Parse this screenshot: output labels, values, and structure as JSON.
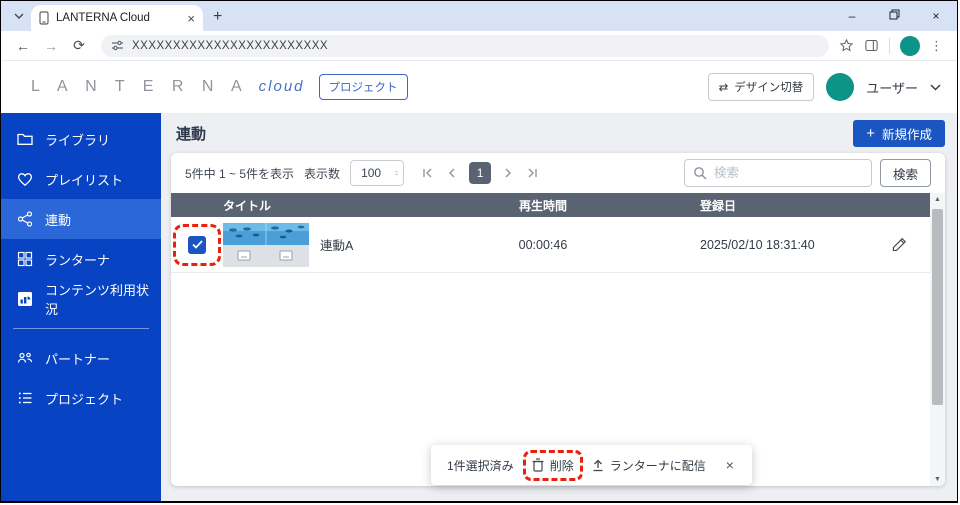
{
  "browser": {
    "tab_title": "LANTERNA Cloud",
    "url": "XXXXXXXXXXXXXXXXXXXXXXXX",
    "new_tab": "+",
    "minimize": "–",
    "close": "×",
    "kebab": "⋮",
    "tab_close": "×"
  },
  "header": {
    "logo_main": "L A N T E R N A",
    "logo_sub": "cloud",
    "project_button": "プロジェクト",
    "design_switch_icon": "⇄",
    "design_switch": "デザイン切替",
    "user": "ユーザー"
  },
  "sidebar": {
    "items": [
      {
        "label": "ライブラリ"
      },
      {
        "label": "プレイリスト"
      },
      {
        "label": "連動"
      },
      {
        "label": "ランターナ"
      },
      {
        "label": "コンテンツ利用状況"
      },
      {
        "label": "パートナー"
      },
      {
        "label": "プロジェクト"
      }
    ]
  },
  "main": {
    "title": "連動",
    "create_button": "新規作成",
    "create_plus": "+",
    "pagination": {
      "summary": "5件中 1 ~ 5件を表示",
      "per_page_label": "表示数",
      "per_page_value": "100",
      "page": "1"
    },
    "search": {
      "placeholder": "検索",
      "button": "検索"
    },
    "table": {
      "headers": [
        "タイトル",
        "再生時間",
        "登録日"
      ],
      "rows": [
        {
          "title": "連動A",
          "duration": "00:00:46",
          "registered": "2025/02/10 18:31:40"
        }
      ]
    },
    "selection_bar": {
      "selected_count": "1件選択済み",
      "delete": "削除",
      "distribute": "ランターナに配信",
      "close": "×"
    }
  },
  "colors": {
    "sidebar_blue": "#0743c2",
    "active_item_blue": "#2b67d8",
    "accent_blue": "#1b55c1",
    "table_header_gray": "#5a6372",
    "avatar_teal": "#0d9488",
    "annotation_red": "#e8210d"
  }
}
